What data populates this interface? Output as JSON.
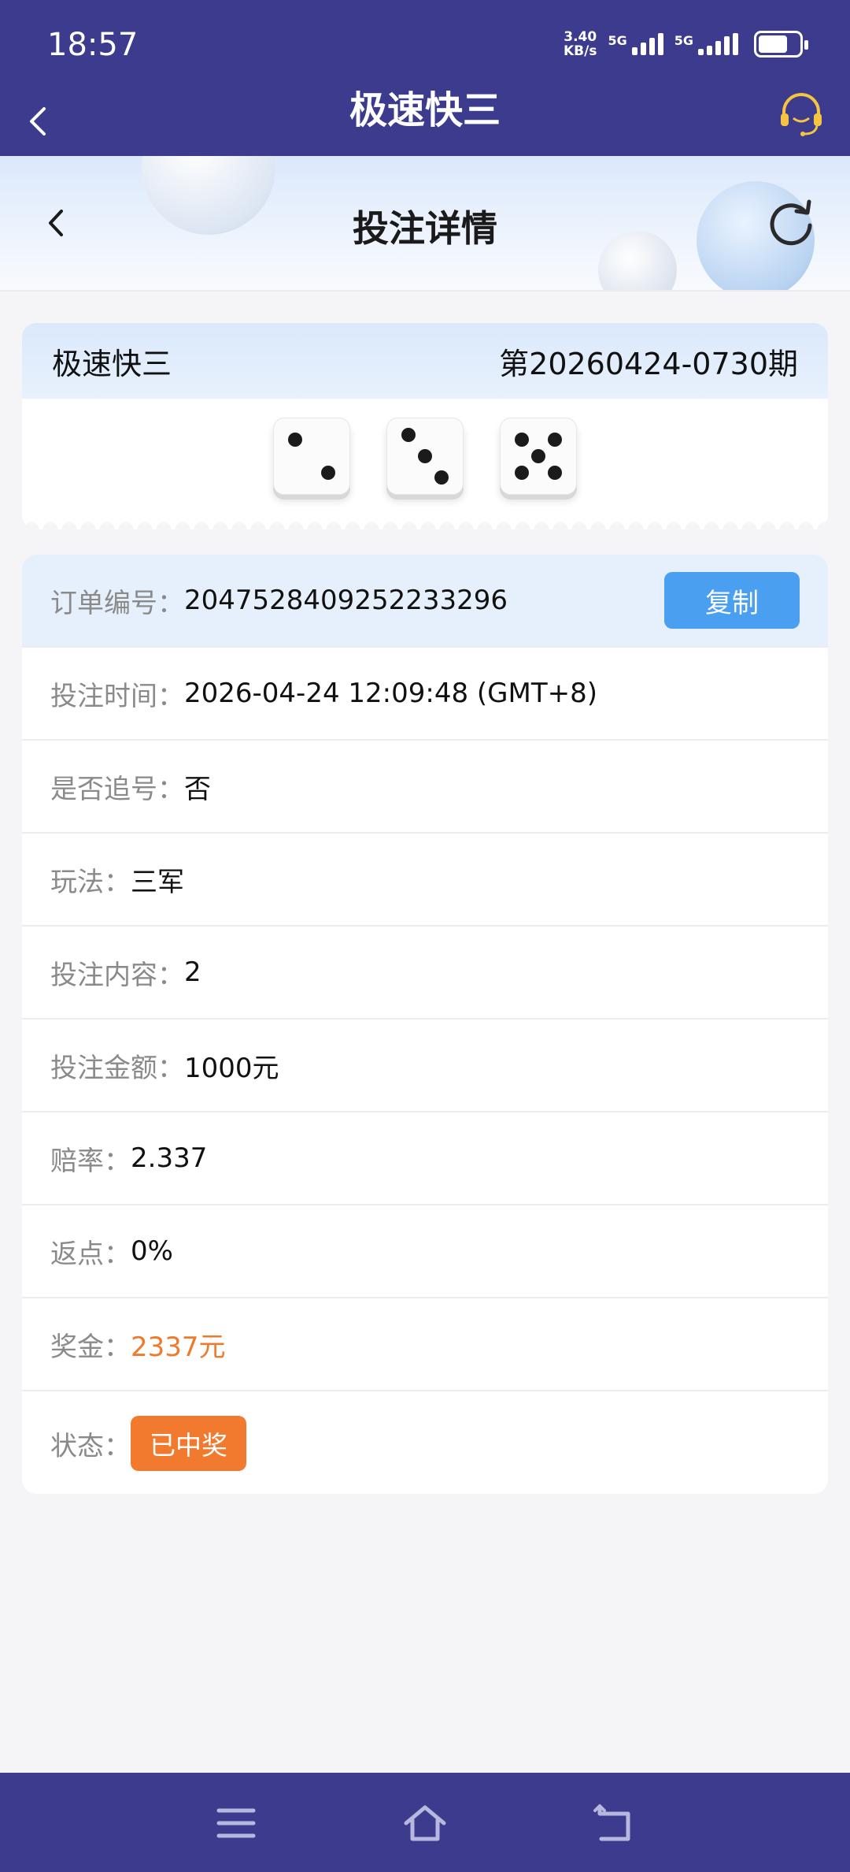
{
  "status_bar": {
    "time": "18:57",
    "net_speed_value": "3.40",
    "net_speed_unit": "KB/s",
    "sim1_label": "5G",
    "sim2_label": "5G"
  },
  "app_header": {
    "title": "极速快三",
    "back_icon": "chevron-left-icon",
    "support_icon": "headset-icon"
  },
  "page_header": {
    "title": "投注详情",
    "back_icon": "chevron-left-icon",
    "refresh_icon": "refresh-icon"
  },
  "draw": {
    "game_name": "极速快三",
    "issue": "第20260424-0730期",
    "dice": [
      2,
      3,
      5
    ]
  },
  "details": {
    "order_label": "订单编号：",
    "order_value": "2047528409252233296",
    "copy_label": "复制",
    "time_label": "投注时间：",
    "time_value": "2026-04-24 12:09:48 (GMT+8)",
    "chase_label": "是否追号：",
    "chase_value": "否",
    "play_label": "玩法：",
    "play_value": "三军",
    "content_label": "投注内容：",
    "content_value": "2",
    "amount_label": "投注金额：",
    "amount_value": "1000元",
    "odds_label": "赔率：",
    "odds_value": "2.337",
    "rebate_label": "返点：",
    "rebate_value": "0%",
    "prize_label": "奖金：",
    "prize_value": "2337元",
    "status_label": "状态：",
    "status_value": "已中奖"
  },
  "colors": {
    "header_bg": "#3c3b8e",
    "accent_blue": "#4a9ff0",
    "accent_orange": "#f07a2b"
  },
  "nav_bar": {
    "icons": [
      "menu-icon",
      "home-icon",
      "back-icon"
    ]
  }
}
